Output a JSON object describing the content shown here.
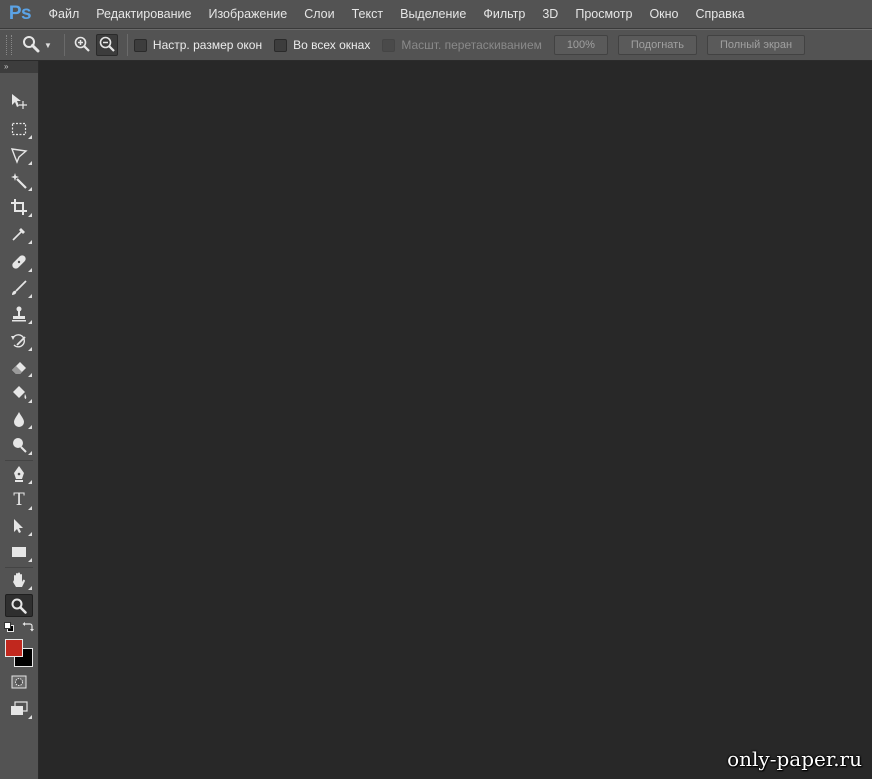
{
  "app": {
    "logo": "Ps",
    "accent_color": "#5ba3e6"
  },
  "menu": {
    "items": [
      "Файл",
      "Редактирование",
      "Изображение",
      "Слои",
      "Текст",
      "Выделение",
      "Фильтр",
      "3D",
      "Просмотр",
      "Окно",
      "Справка"
    ]
  },
  "options": {
    "current_tool_icon": "zoom-icon",
    "zoom_in_icon": "zoom-in-icon",
    "zoom_out_icon": "zoom-out-icon",
    "checkboxes": {
      "resize_windows": {
        "label": "Настр. размер окон",
        "checked": false
      },
      "all_windows": {
        "label": "Во всех окнах",
        "checked": false
      },
      "scrubby_zoom": {
        "label": "Масшт. перетаскиванием",
        "checked": false,
        "disabled": true
      }
    },
    "buttons": {
      "percent": "100%",
      "fit": "Подогнать",
      "fullscreen": "Полный экран"
    }
  },
  "toolbox": {
    "collapse_glyph": "»",
    "tools": [
      "move-tool-icon",
      "marquee-tool-icon",
      "lasso-tool-icon",
      "magic-wand-tool-icon",
      "crop-tool-icon",
      "eyedropper-tool-icon",
      "healing-brush-tool-icon",
      "brush-tool-icon",
      "clone-stamp-tool-icon",
      "history-brush-tool-icon",
      "eraser-tool-icon",
      "paint-bucket-tool-icon",
      "blur-tool-icon",
      "dodge-tool-icon",
      "pen-tool-icon",
      "type-tool-icon",
      "path-selection-tool-icon",
      "rectangle-tool-icon",
      "hand-tool-icon",
      "zoom-tool-icon"
    ],
    "active_tool": "zoom-tool-icon",
    "type_tool_glyph": "T",
    "foreground_color": "#c1281e",
    "background_color": "#000000"
  },
  "canvas": {
    "background_color": "#282828"
  },
  "watermark": "only-paper.ru"
}
